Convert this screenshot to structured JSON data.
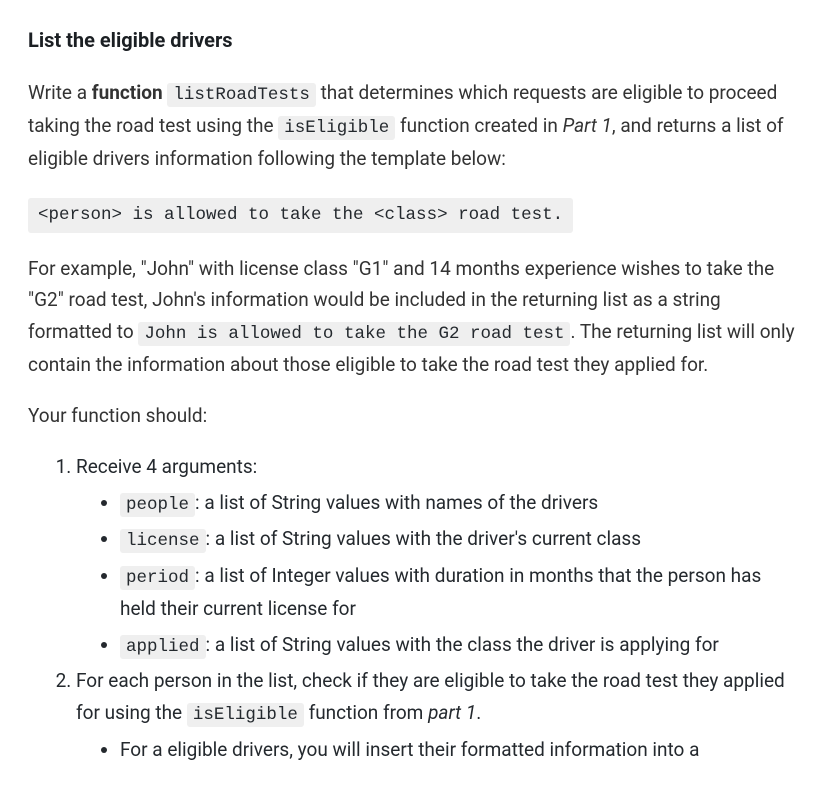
{
  "heading": "List the eligible drivers",
  "p1": {
    "t1": "Write a ",
    "b1": "function",
    "sp1": " ",
    "c1": "listRoadTests",
    "t2": " that determines which requests are eligible to proceed taking the road test using the ",
    "c2": "isEligible",
    "t3": " function created in ",
    "i1": "Part 1",
    "t4": ", and returns a list of eligible drivers information following the template below:"
  },
  "template_code": "<person> is allowed to take the <class> road test.",
  "p2": {
    "t1": "For example, \"John\" with license class \"G1\" and 14 months experience wishes to take the \"G2\" road test, John's information would be included in the returning list as a string formatted to ",
    "c1": "John is allowed to take the G2 road test",
    "t2": ". The returning list will only contain the information about those eligible to take the road test they applied for."
  },
  "p3": "Your function should:",
  "list": {
    "item1": {
      "lead": "Receive 4 arguments:",
      "bullets": {
        "b1": {
          "code": "people",
          "text": ": a list of String values with names of the drivers"
        },
        "b2": {
          "code": "license",
          "text": ": a list of String values with the driver's current class"
        },
        "b3": {
          "code": "period",
          "text": ": a list of Integer values with duration in months that the person has held their current license for"
        },
        "b4": {
          "code": "applied",
          "text": ": a list of String values with the class the driver is applying for"
        }
      }
    },
    "item2": {
      "t1": "For each person in the list, check if they are eligible to take the road test they applied for using the ",
      "c1": "isEligible",
      "t2": " function from ",
      "i1": "part 1",
      "t3": ".",
      "bullets": {
        "b1": "For a eligible drivers, you will insert their formatted information into a"
      }
    }
  }
}
